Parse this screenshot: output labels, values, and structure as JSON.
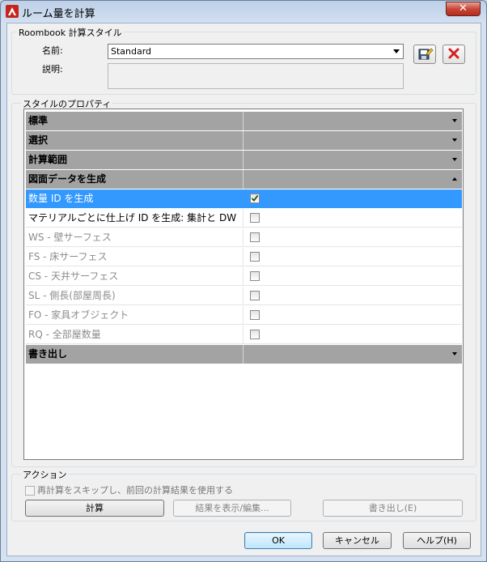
{
  "window": {
    "title": "ルーム量を計算",
    "close_label": "✕"
  },
  "style_group": {
    "label": "Roombook 計算スタイル",
    "name_label": "名前:",
    "name_value": "Standard",
    "description_label": "説明:"
  },
  "properties": {
    "label": "スタイルのプロパティ",
    "rows": [
      {
        "type": "category",
        "label": "標準",
        "expanded": false
      },
      {
        "type": "category",
        "label": "選択",
        "expanded": false
      },
      {
        "type": "category",
        "label": "計算範囲",
        "expanded": false
      },
      {
        "type": "category",
        "label": "図面データを生成",
        "expanded": true
      },
      {
        "type": "property",
        "label": "数量 ID を生成",
        "checked": true,
        "enabled": true,
        "selected": true
      },
      {
        "type": "property",
        "label": "マテリアルごとに仕上げ ID を生成: 集計と DW",
        "checked": false,
        "enabled": true,
        "selected": false
      },
      {
        "type": "property",
        "label": "WS - 壁サーフェス",
        "checked": false,
        "enabled": false,
        "selected": false
      },
      {
        "type": "property",
        "label": "FS - 床サーフェス",
        "checked": false,
        "enabled": false,
        "selected": false
      },
      {
        "type": "property",
        "label": "CS - 天井サーフェス",
        "checked": false,
        "enabled": false,
        "selected": false
      },
      {
        "type": "property",
        "label": "SL - 側長(部屋周長)",
        "checked": false,
        "enabled": false,
        "selected": false
      },
      {
        "type": "property",
        "label": "FO - 家具オブジェクト",
        "checked": false,
        "enabled": false,
        "selected": false
      },
      {
        "type": "property",
        "label": "RQ - 全部屋数量",
        "checked": false,
        "enabled": false,
        "selected": false
      },
      {
        "type": "category",
        "label": "書き出し",
        "expanded": false
      }
    ]
  },
  "actions": {
    "label": "アクション",
    "skip_label": "再計算をスキップし、前回の計算結果を使用する",
    "calculate": "計算",
    "show_edit": "結果を表示/編集...",
    "export": "書き出し(E)"
  },
  "footer": {
    "ok": "OK",
    "cancel": "キャンセル",
    "help": "ヘルプ(H)"
  },
  "colors": {
    "selection": "#3399ff",
    "category": "#a3a3a3",
    "close": "#c8463a",
    "delete_icon": "#d42020"
  }
}
